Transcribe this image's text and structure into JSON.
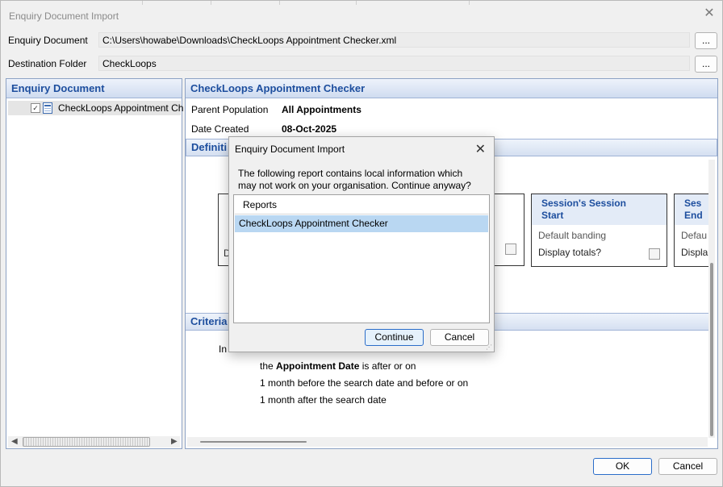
{
  "window": {
    "title": "Enquiry Document Import"
  },
  "fields": {
    "enquiry_document_label": "Enquiry Document",
    "enquiry_document_value": "C:\\Users\\howabe\\Downloads\\CheckLoops Appointment Checker.xml",
    "destination_folder_label": "Destination Folder",
    "destination_folder_value": "CheckLoops",
    "browse_label": "..."
  },
  "left_panel": {
    "header": "Enquiry Document",
    "items": [
      {
        "label": "CheckLoops Appointment Ch",
        "checked": true
      }
    ]
  },
  "right_panel": {
    "header": "CheckLoops Appointment Checker",
    "parent_population_label": "Parent Population",
    "parent_population_value": "All Appointments",
    "date_created_label": "Date Created",
    "date_created_value": "08-Oct-2025",
    "definition_header": "Definiti",
    "cards": [
      {
        "title_line1": "Session's Session",
        "title_line2": "Start",
        "banding": "Default banding",
        "totals": "Display totals?"
      },
      {
        "title_line1": "Ses",
        "title_line2": "End",
        "banding": "Defau",
        "totals": "Displa"
      }
    ],
    "partial_card_label": "D",
    "criteria_header": "Criteria",
    "criteria_prefix": "In",
    "criteria_line1_pre": "the",
    "criteria_line1_bold": "Appointment Date",
    "criteria_line1_post": "is  after or on",
    "criteria_line2": "1 month before the search date and before or on",
    "criteria_line3": "1 month after the search date"
  },
  "footer": {
    "ok": "OK",
    "cancel": "Cancel"
  },
  "dialog": {
    "title": "Enquiry Document Import",
    "message": "The following report contains local information which may not work on your organisation. Continue anyway?",
    "list_header": "Reports",
    "list_items": [
      "CheckLoops Appointment Checker"
    ],
    "continue": "Continue",
    "cancel": "Cancel"
  },
  "icons": {
    "close": "close-icon",
    "doc": "report-document-icon",
    "checkbox": "checkbox-icon"
  },
  "colors": {
    "accent_header": "#1d4e9e",
    "selection": "#b9d7f2",
    "header_gradient_bottom": "#cfdcf0"
  }
}
